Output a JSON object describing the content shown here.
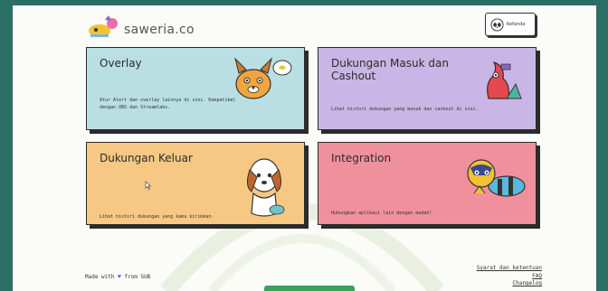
{
  "brand": "saweria.co",
  "user": {
    "name": "Kefanda"
  },
  "cards": [
    {
      "title": "Overlay",
      "desc": "Atur Alert dan overlay lainnya di sini. Kompatibel dengan OBS dan Streamlabs."
    },
    {
      "title": "Dukungan Masuk dan Cashout",
      "desc": "Lihat histori dukungan yang masuk dan cashout di sini."
    },
    {
      "title": "Dukungan Keluar",
      "desc": "Lihat histori dukungan yang kamu kirimkan."
    },
    {
      "title": "Integration",
      "desc": "Hubungkan aplikasi lain dengan mudah!"
    }
  ],
  "footer": {
    "made_with": "Made with",
    "from": "from SUB",
    "links": [
      "Syarat dan ketentuan",
      "FAQ",
      "Changelog"
    ]
  },
  "colors": {
    "overlay": "#b9dfe3",
    "masuk": "#c9b6e6",
    "keluar": "#f7c883",
    "integration": "#f1909d",
    "frame": "#2b6e64"
  }
}
